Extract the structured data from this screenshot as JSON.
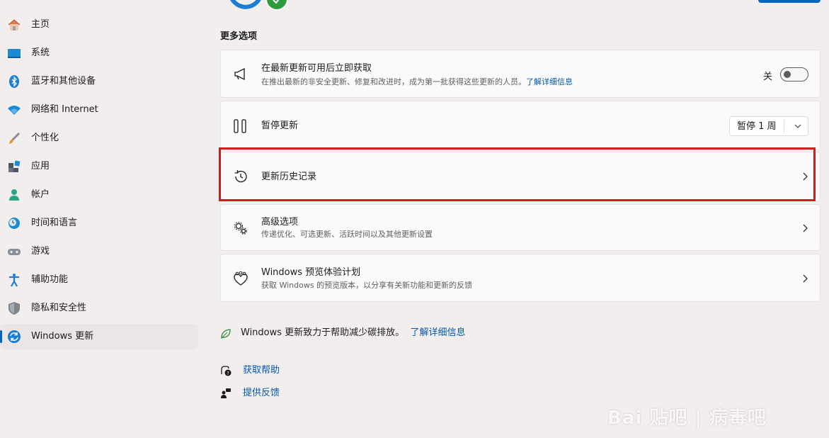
{
  "sidebar": {
    "items": [
      {
        "label": "主页",
        "icon": "home-icon"
      },
      {
        "label": "系统",
        "icon": "system-icon"
      },
      {
        "label": "蓝牙和其他设备",
        "icon": "bluetooth-icon"
      },
      {
        "label": "网络和 Internet",
        "icon": "wifi-icon"
      },
      {
        "label": "个性化",
        "icon": "brush-icon"
      },
      {
        "label": "应用",
        "icon": "apps-icon"
      },
      {
        "label": "帐户",
        "icon": "account-icon"
      },
      {
        "label": "时间和语言",
        "icon": "time-language-icon"
      },
      {
        "label": "游戏",
        "icon": "gamepad-icon"
      },
      {
        "label": "辅助功能",
        "icon": "accessibility-icon"
      },
      {
        "label": "隐私和安全性",
        "icon": "shield-icon"
      },
      {
        "label": "Windows 更新",
        "icon": "windows-update-icon",
        "active": true
      }
    ]
  },
  "main": {
    "section_title": "更多选项",
    "get_latest": {
      "title": "在最新更新可用后立即获取",
      "subtitle": "在推出最新的非安全更新、修复和改进时，成为第一批获得这些更新的人员。",
      "link": "了解详细信息",
      "toggle_label": "关",
      "toggle_on": false
    },
    "pause": {
      "title": "暂停更新",
      "select_value": "暂停 1 周"
    },
    "history": {
      "title": "更新历史记录"
    },
    "advanced": {
      "title": "高级选项",
      "subtitle": "传递优化、可选更新、活跃时间以及其他更新设置"
    },
    "insider": {
      "title": "Windows 预览体验计划",
      "subtitle": "获取 Windows 的预览版本，以分享有关新功能和更新的反馈"
    },
    "eco": {
      "text": "Windows 更新致力于帮助减少碳排放。",
      "link": "了解详细信息"
    },
    "help": {
      "get_help": "获取帮助",
      "feedback": "提供反馈"
    }
  },
  "watermark": {
    "text": "Bai 贴吧 | 病毒吧"
  },
  "colors": {
    "accent": "#0067c0",
    "highlight_border": "#cc1f1f",
    "background": "#f3eeee"
  }
}
